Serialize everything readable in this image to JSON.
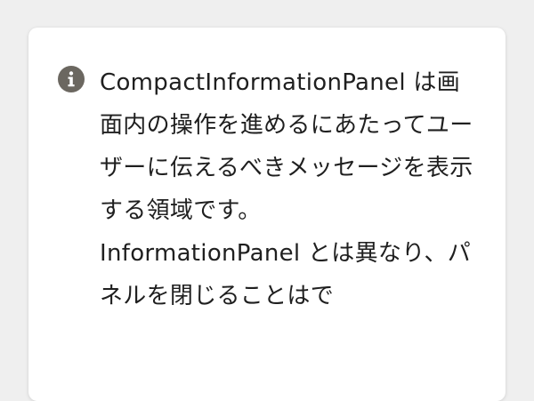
{
  "panel": {
    "icon": "info-icon",
    "paragraphs": [
      "CompactInformationPanel は画面内の操作を進めるにあたってユーザーに伝えるべきメッセージを表示する領域です。",
      "InformationPanel とは異なり、パネルを閉じることはで"
    ]
  },
  "colors": {
    "background": "#efefef",
    "panel": "#ffffff",
    "icon": "#6b6760",
    "text": "#1f1f1f"
  }
}
